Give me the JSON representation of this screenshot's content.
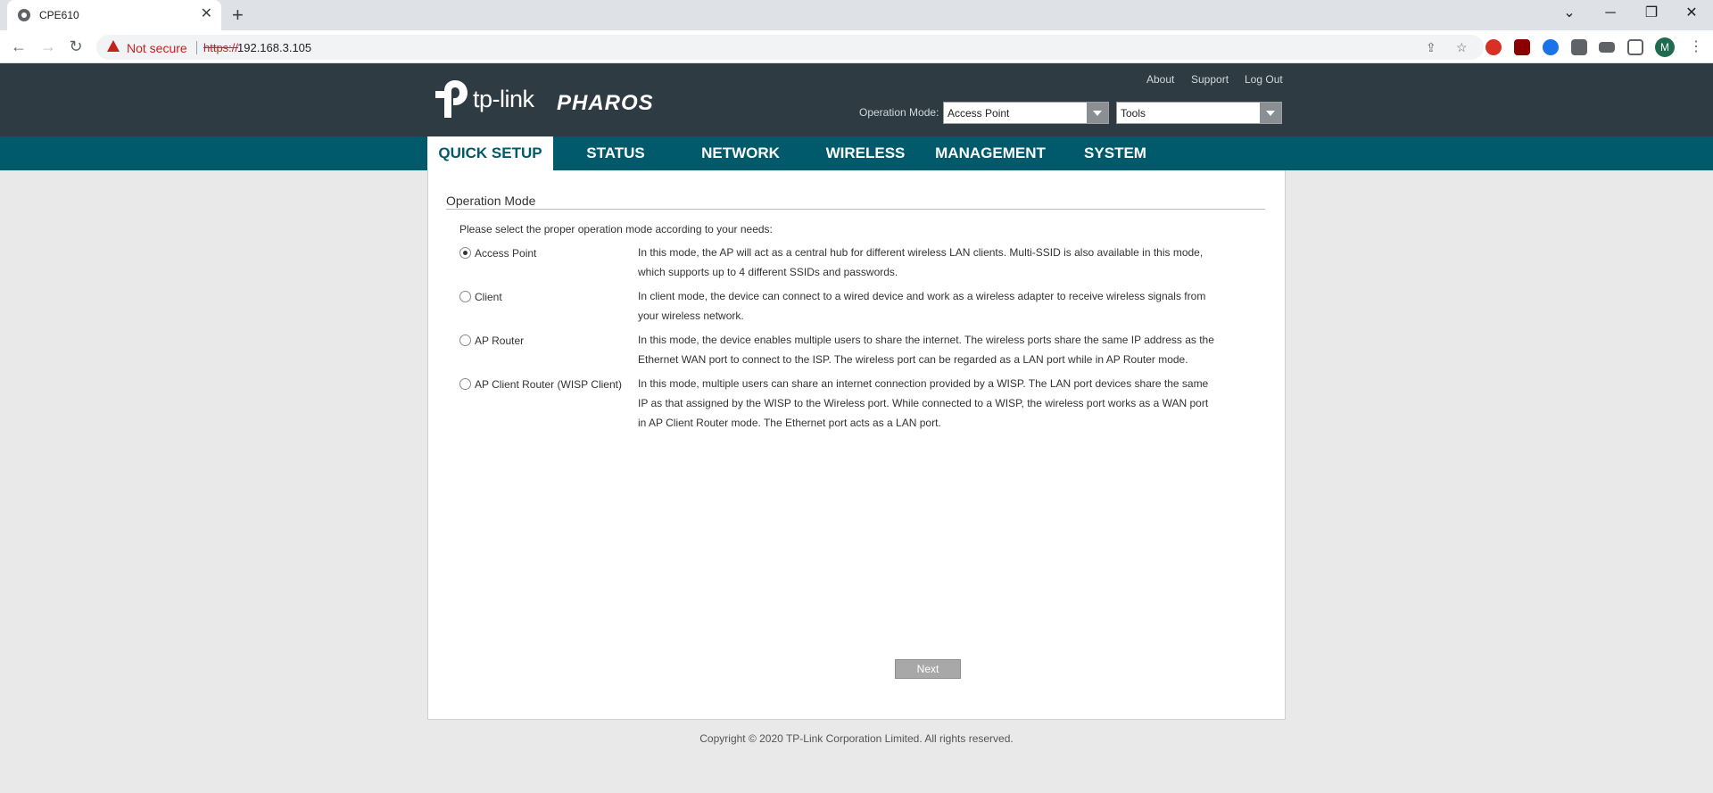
{
  "browser": {
    "tab_title": "CPE610",
    "tab_close": "✕",
    "new_tab": "+",
    "window_controls": {
      "minimize": "─",
      "restore": "❐",
      "close": "✕",
      "tabs_menu": "⌄"
    },
    "security_text": "Not secure",
    "url_scheme": "https://",
    "url_host": "192.168.3.105",
    "profile_initial": "M",
    "nav": {
      "back": "←",
      "forward": "→",
      "reload": "↻",
      "share": "⇪",
      "star": "☆",
      "menu": "⋮"
    }
  },
  "header": {
    "logo_text": "tp-link",
    "product_name": "PHAROS",
    "links": {
      "about": "About",
      "support": "Support",
      "logout": "Log Out"
    },
    "operation_mode_label": "Operation Mode:",
    "operation_mode_value": "Access Point",
    "tools_value": "Tools"
  },
  "nav": {
    "tabs": [
      {
        "label": "QUICK SETUP",
        "active": true
      },
      {
        "label": "STATUS",
        "active": false
      },
      {
        "label": "NETWORK",
        "active": false
      },
      {
        "label": "WIRELESS",
        "active": false
      },
      {
        "label": "MANAGEMENT",
        "active": false
      },
      {
        "label": "SYSTEM",
        "active": false
      }
    ]
  },
  "content": {
    "section_title": "Operation Mode",
    "intro": "Please select the proper operation mode according to your needs:",
    "modes": [
      {
        "label": "Access Point",
        "checked": true,
        "description": "In this mode, the AP will act as a central hub for different wireless LAN clients. Multi-SSID is also available in this mode, which supports up to 4 different SSIDs and passwords."
      },
      {
        "label": "Client",
        "checked": false,
        "description": "In client mode, the device can connect to a wired device and work as a wireless adapter to receive wireless signals from your wireless network."
      },
      {
        "label": "AP Router",
        "checked": false,
        "description": "In this mode, the device enables multiple users to share the internet. The wireless ports share the same IP address as the Ethernet WAN port to connect to the ISP. The wireless port can be regarded as a LAN port while in AP Router mode."
      },
      {
        "label": "AP Client Router (WISP Client)",
        "checked": false,
        "description": "In this mode, multiple users can share an internet connection provided by a WISP. The LAN port devices share the same IP as that assigned by the WISP to the Wireless port. While connected to a WISP, the wireless port works as a WAN port in AP Client Router mode. The Ethernet port acts as a LAN port."
      }
    ],
    "next_label": "Next"
  },
  "footer": {
    "copyright": "Copyright © 2020 TP-Link Corporation Limited. All rights reserved."
  },
  "colors": {
    "header_bg": "#2f3b42",
    "nav_bg": "#005a6b",
    "security_red": "#c5221f"
  }
}
